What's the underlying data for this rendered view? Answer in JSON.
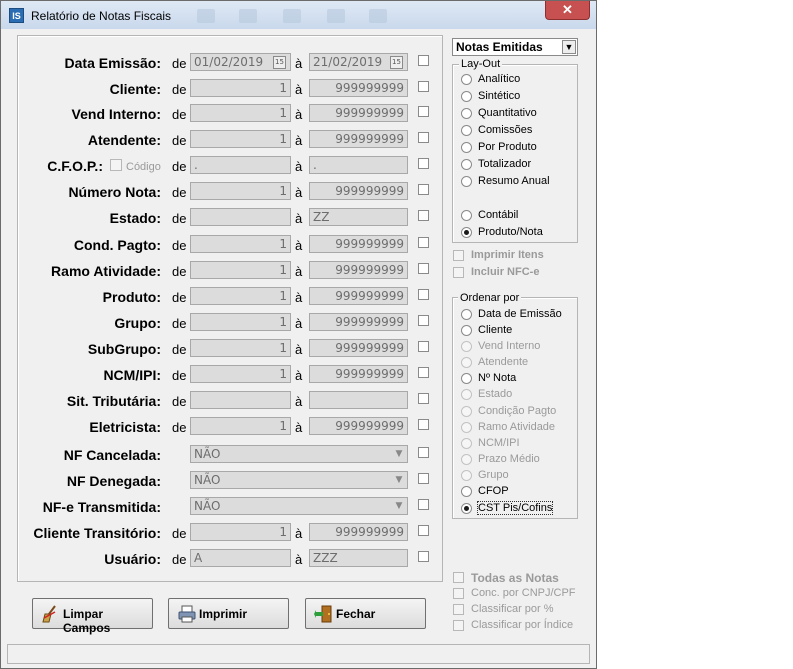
{
  "window": {
    "title": "Relatório de Notas Fiscais",
    "close_label": "✕",
    "icon_text": "IS"
  },
  "filter_words": {
    "from": "de",
    "to": "à"
  },
  "rows": [
    {
      "label": "Data Emissão:",
      "from": "01/02/2019",
      "to": "21/02/2019"
    },
    {
      "label": "Cliente:",
      "from": "1",
      "to": "999999999"
    },
    {
      "label": "Vend Interno:",
      "from": "1",
      "to": "999999999"
    },
    {
      "label": "Atendente:",
      "from": "1",
      "to": "999999999"
    },
    {
      "label": "C.F.O.P.:",
      "extra": "Código",
      "from": ".",
      "to": "."
    },
    {
      "label": "Número Nota:",
      "from": "1",
      "to": "999999999"
    },
    {
      "label": "Estado:",
      "from": "",
      "to": "ZZ"
    },
    {
      "label": "Cond. Pagto:",
      "from": "1",
      "to": "999999999"
    },
    {
      "label": "Ramo Atividade:",
      "from": "1",
      "to": "999999999"
    },
    {
      "label": "Produto:",
      "from": "1",
      "to": "999999999"
    },
    {
      "label": "Grupo:",
      "from": "1",
      "to": "999999999"
    },
    {
      "label": "SubGrupo:",
      "from": "1",
      "to": "999999999"
    },
    {
      "label": "NCM/IPI:",
      "from": "1",
      "to": "999999999"
    },
    {
      "label": "Sit. Tributária:",
      "from": "",
      "to": ""
    },
    {
      "label": "Eletricista:",
      "from": "1",
      "to": "999999999"
    },
    {
      "label": "NF Cancelada:",
      "select": "NÃO"
    },
    {
      "label": "NF Denegada:",
      "select": "NÃO"
    },
    {
      "label": "NF-e Transmitida:",
      "select": "NÃO"
    },
    {
      "label": "Cliente Transitório:",
      "from": "1",
      "to": "999999999"
    },
    {
      "label": "Usuário:",
      "from": "A",
      "to": "ZZZ"
    }
  ],
  "calendar_icon_text": "15",
  "dropdown_arrow": "▼",
  "notes_combo": {
    "value": "Notas Emitidas"
  },
  "layout_group": {
    "title": "Lay-Out",
    "options": [
      "Analítico",
      "Sintético",
      "Quantitativo",
      "Comissões",
      "Por Produto",
      "Totalizador",
      "Resumo Anual",
      "Contábil",
      "Produto/Nota"
    ],
    "selected": "Produto/Nota"
  },
  "print_options": [
    "Imprimir Itens",
    "Incluir NFC-e"
  ],
  "order_group": {
    "title": "Ordenar por",
    "options": [
      "Data de Emissão",
      "Cliente",
      "Vend Interno",
      "Atendente",
      "Nº Nota",
      "Estado",
      "Condição Pagto",
      "Ramo Atividade",
      "NCM/IPI",
      "Prazo Médio",
      "Grupo",
      "CFOP",
      "CST Pis/Cofins"
    ],
    "disabled": [
      "Vend Interno",
      "Atendente",
      "Estado",
      "Condição Pagto",
      "Ramo Atividade",
      "NCM/IPI",
      "Prazo Médio",
      "Grupo"
    ],
    "selected": "CST Pis/Cofins"
  },
  "bottom_options": [
    "Todas as Notas",
    "Conc. por CNPJ/CPF",
    "Classificar por %",
    "Classificar por Índice"
  ],
  "buttons": {
    "clear": "Limpar Campos",
    "print": "Imprimir",
    "close": "Fechar"
  }
}
